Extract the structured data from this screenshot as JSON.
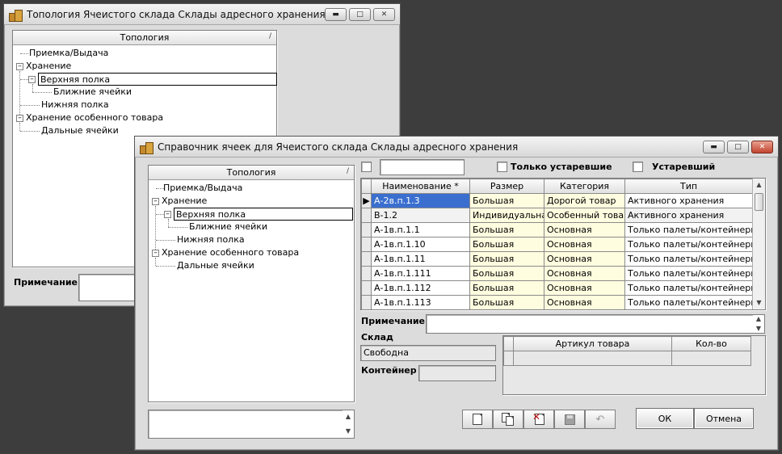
{
  "back_window": {
    "title": "Топология Ячеистого склада Склады адресного хранения",
    "tree_header": "Топология",
    "tree": [
      "Приемка/Выдача",
      "Хранение",
      "Верхняя полка",
      "Ближние ячейки",
      "Нижняя полка",
      "Хранение особенного товара",
      "Дальные ячейки"
    ],
    "note_label": "Примечание"
  },
  "front_window": {
    "title": "Справочник ячеек для Ячеистого склада Склады адресного хранения",
    "tree_header": "Топология",
    "tree": [
      "Приемка/Выдача",
      "Хранение",
      "Верхняя полка",
      "Ближние ячейки",
      "Нижняя полка",
      "Хранение особенного товара",
      "Дальные ячейки"
    ],
    "filter": {
      "search_value": "",
      "only_obsolete_label": "Только устаревшие",
      "obsolete_label": "Устаревший"
    },
    "grid": {
      "columns": [
        "Наименование *",
        "Размер",
        "Категория",
        "Тип"
      ],
      "rows": [
        [
          "А-2в.п.1.3",
          "Большая",
          "Дорогой товар",
          "Активного хранения"
        ],
        [
          "В-1.2",
          "Индивидуальная",
          "Особенный товар",
          "Активного хранения"
        ],
        [
          "А-1в.п.1.1",
          "Большая",
          "Основная",
          "Только палеты/контейнеры"
        ],
        [
          "А-1в.п.1.10",
          "Большая",
          "Основная",
          "Только палеты/контейнеры"
        ],
        [
          "А-1в.п.1.11",
          "Большая",
          "Основная",
          "Только палеты/контейнеры"
        ],
        [
          "А-1в.п.1.111",
          "Большая",
          "Основная",
          "Только палеты/контейнеры"
        ],
        [
          "А-1в.п.1.112",
          "Большая",
          "Основная",
          "Только палеты/контейнеры"
        ],
        [
          "А-1в.п.1.113",
          "Большая",
          "Основная",
          "Только палеты/контейнеры"
        ]
      ]
    },
    "note_label": "Примечание",
    "warehouse_label": "Склад",
    "warehouse_value": "Свободна",
    "container_label": "Контейнер",
    "articles": {
      "columns": [
        "Артикул товара",
        "Кол-во"
      ]
    },
    "buttons": {
      "ok": "ОК",
      "cancel": "Отмена"
    },
    "colors": {
      "selection": "#3a6fcf",
      "highlight_cells": "#fffddf"
    }
  }
}
